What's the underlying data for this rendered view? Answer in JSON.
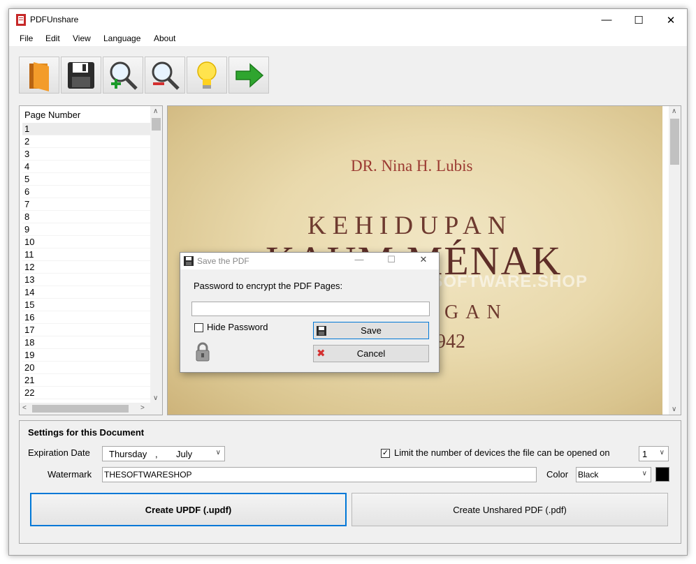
{
  "window": {
    "title": "PDFUnshare",
    "controls": {
      "minimize": "—",
      "maximize": "☐",
      "close": "✕"
    }
  },
  "menu": {
    "items": [
      "File",
      "Edit",
      "View",
      "Language",
      "About"
    ]
  },
  "toolbar": {
    "buttons": [
      {
        "name": "open-file-icon"
      },
      {
        "name": "save-floppy-icon"
      },
      {
        "name": "zoom-in-icon"
      },
      {
        "name": "zoom-out-icon"
      },
      {
        "name": "lightbulb-icon"
      },
      {
        "name": "green-arrow-icon"
      }
    ]
  },
  "page_list": {
    "header": "Page Number",
    "selected": "1",
    "pages": [
      "1",
      "2",
      "3",
      "4",
      "5",
      "6",
      "7",
      "8",
      "9",
      "10",
      "11",
      "12",
      "13",
      "14",
      "15",
      "16",
      "17",
      "18",
      "19",
      "20",
      "21",
      "22"
    ]
  },
  "preview": {
    "author": "DR. Nina H. Lubis",
    "line1": "KEHIDUPAN",
    "line2": "KAUM MÉNAK",
    "line3": "GAN",
    "line4": "942",
    "watermark": "© THESOFTWARE.SHOP"
  },
  "dialog": {
    "title": "Save the PDF",
    "prompt": "Password to encrypt the PDF Pages:",
    "password_value": "",
    "hide_password_label": "Hide Password",
    "hide_password_checked": false,
    "save_label": "Save",
    "cancel_label": "Cancel"
  },
  "settings": {
    "title": "Settings for this Document",
    "expiration_label": "Expiration Date",
    "expiration_day": "Thursday",
    "expiration_sep": ",",
    "expiration_month": "July",
    "limit_label": "Limit the number of devices the file can be opened on",
    "limit_checked": true,
    "limit_value": "1",
    "watermark_label": "Watermark",
    "watermark_value": "THESOFTWARESHOP",
    "color_label": "Color",
    "color_value": "Black",
    "color_swatch": "#000000",
    "create_updf_label": "Create UPDF (.updf)",
    "create_pdf_label": "Create Unshared PDF (.pdf)"
  },
  "colors": {
    "accent_border": "#0078d7",
    "book_red": "#9b3a32"
  }
}
